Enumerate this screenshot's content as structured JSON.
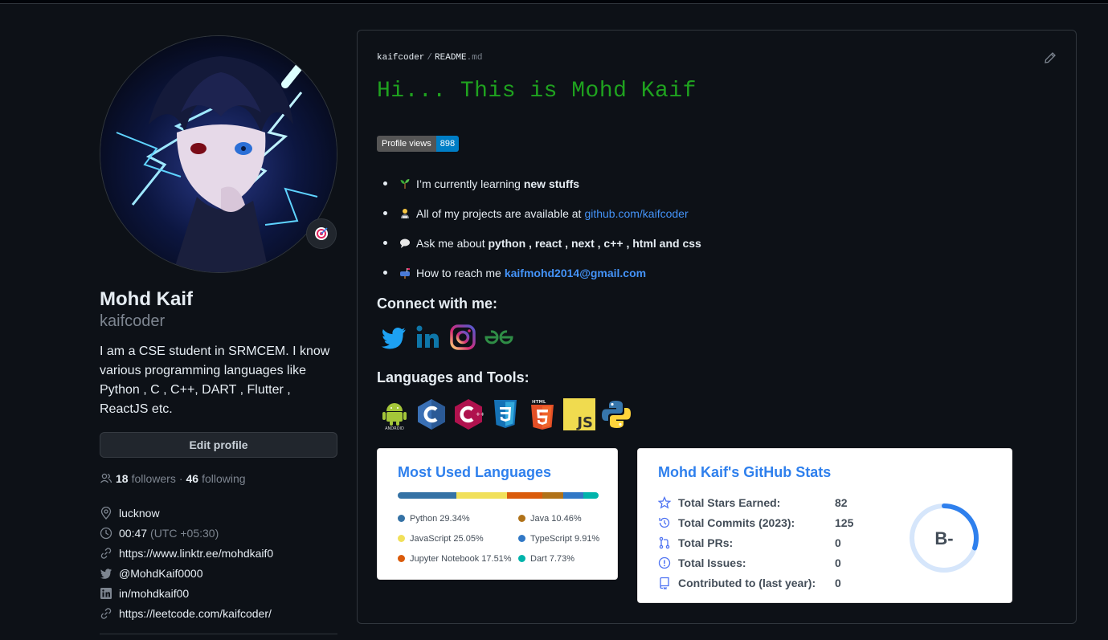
{
  "profile": {
    "name": "Mohd Kaif",
    "login": "kaifcoder",
    "bio": "I am a CSE student in SRMCEM. I know various programming languages like Python , C , C++, DART , Flutter , ReactJS etc.",
    "edit_label": "Edit profile",
    "followers_count": "18",
    "followers_label": "followers",
    "separator": "·",
    "following_count": "46",
    "following_label": "following",
    "location": "lucknow",
    "time": "00:47",
    "timezone": "(UTC +05:30)",
    "website": "https://www.linktr.ee/mohdkaif0",
    "twitter": "@MohdKaif0000",
    "linkedin": "in/mohdkaif00",
    "leetcode": "https://leetcode.com/kaifcoder/"
  },
  "readme": {
    "owner": "kaifcoder",
    "file_base": "README",
    "file_ext": ".md",
    "heading": "Hi... This is Mohd Kaif",
    "badge_label": "Profile views",
    "badge_value": "898",
    "bullet1_text": "I’m currently learning",
    "bullet1_bold": "new stuffs",
    "bullet2_text": "All of my projects are available at",
    "bullet2_link": "github.com/kaifcoder",
    "bullet3_text": "Ask me about",
    "bullet3_bold": "python , react , next , c++ , html and css",
    "bullet4_text": "How to reach me",
    "bullet4_link": "kaifmohd2014@gmail.com",
    "connect_heading": "Connect with me:",
    "tools_heading": "Languages and Tools:",
    "social_icons": [
      "twitter-icon",
      "linkedin-icon",
      "instagram-icon",
      "geeksforgeeks-icon"
    ],
    "tool_icons": [
      "android-icon",
      "c-icon",
      "cplusplus-icon",
      "css3-icon",
      "html5-icon",
      "javascript-icon",
      "python-icon"
    ]
  },
  "languages_card": {
    "title": "Most Used Languages",
    "items": [
      {
        "name": "Python",
        "percent": "29.34%",
        "value": 29.34,
        "color": "#3572A5"
      },
      {
        "name": "JavaScript",
        "percent": "25.05%",
        "value": 25.05,
        "color": "#f1e05a"
      },
      {
        "name": "Jupyter Notebook",
        "percent": "17.51%",
        "value": 17.51,
        "color": "#DA5B0B"
      },
      {
        "name": "Java",
        "percent": "10.46%",
        "value": 10.46,
        "color": "#b07219"
      },
      {
        "name": "TypeScript",
        "percent": "9.91%",
        "value": 9.91,
        "color": "#3178c6"
      },
      {
        "name": "Dart",
        "percent": "7.73%",
        "value": 7.73,
        "color": "#00B4AB"
      }
    ]
  },
  "stats_card": {
    "title": "Mohd Kaif's GitHub Stats",
    "rows": [
      {
        "label": "Total Stars Earned:",
        "value": "82"
      },
      {
        "label": "Total Commits (2023):",
        "value": "125"
      },
      {
        "label": "Total PRs:",
        "value": "0"
      },
      {
        "label": "Total Issues:",
        "value": "0"
      },
      {
        "label": "Contributed to (last year):",
        "value": "0"
      }
    ],
    "grade": "B-",
    "grade_progress": 0.3,
    "accent": "#2f80ed"
  }
}
